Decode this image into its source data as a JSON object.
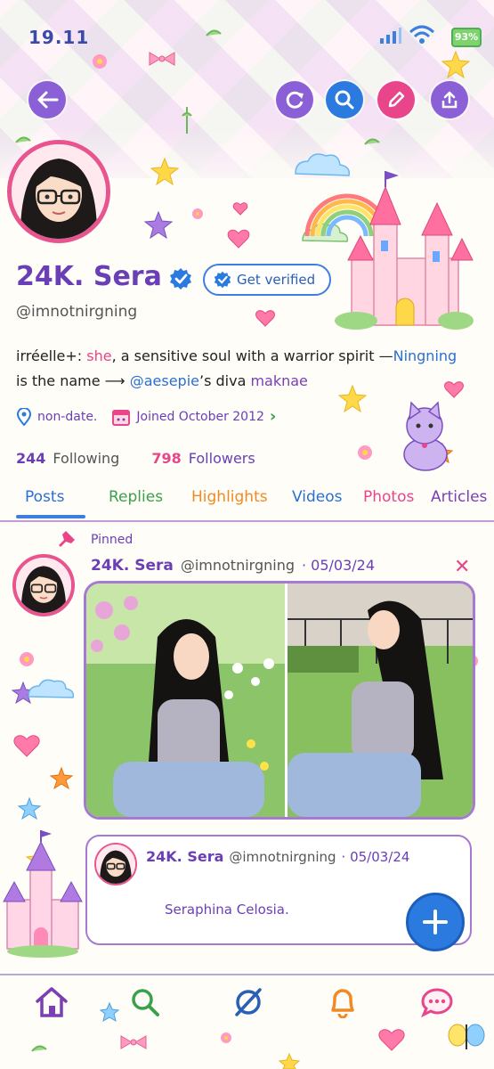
{
  "status_bar": {
    "time": "19.11",
    "battery": "93%"
  },
  "profile": {
    "name": "24K. Sera",
    "get_verified_label": "Get verified",
    "handle": "@imnotnirgning",
    "bio": {
      "line1_a": "irréelle+: ",
      "line1_b": "she",
      "line1_c": ", a sensitive soul with a warrior spirit —",
      "line1_d": "Ningning",
      "line2_a": "is the name ⟶ ",
      "line2_b": "@aesepie",
      "line2_c": "’s diva ",
      "line2_d": "maknae"
    },
    "location": "non-date.",
    "joined": "Joined October 2012",
    "following_count": "244",
    "following_label": "Following",
    "followers_count": "798",
    "followers_label": "Followers"
  },
  "tabs": [
    {
      "label": "Posts",
      "color": "#2a6fd4"
    },
    {
      "label": "Replies",
      "color": "#3aa04a"
    },
    {
      "label": "Highlights",
      "color": "#f08a24"
    },
    {
      "label": "Videos",
      "color": "#2a6fd4"
    },
    {
      "label": "Photos",
      "color": "#e8458a"
    },
    {
      "label": "Articles",
      "color": "#7a3fb5"
    }
  ],
  "post": {
    "pinned_label": "Pinned",
    "author": "24K. Sera",
    "handle": "@imnotnirgning",
    "date": "· 05/03/24",
    "quote": {
      "author": "24K. Sera",
      "handle": "@imnotnirgning",
      "date": "· 05/03/24",
      "text": "Seraphina Celosia."
    }
  },
  "colors": {
    "accent_purple": "#6a3fb5",
    "accent_pink": "#e8458a",
    "accent_blue": "#2a7ae0"
  },
  "icons": {
    "top_bar": [
      "back-arrow-icon",
      "refresh-icon",
      "search-icon",
      "edit-icon",
      "share-icon"
    ],
    "bottom_nav": [
      "home-icon",
      "search-icon",
      "grok-icon",
      "bell-icon",
      "messages-icon"
    ]
  }
}
